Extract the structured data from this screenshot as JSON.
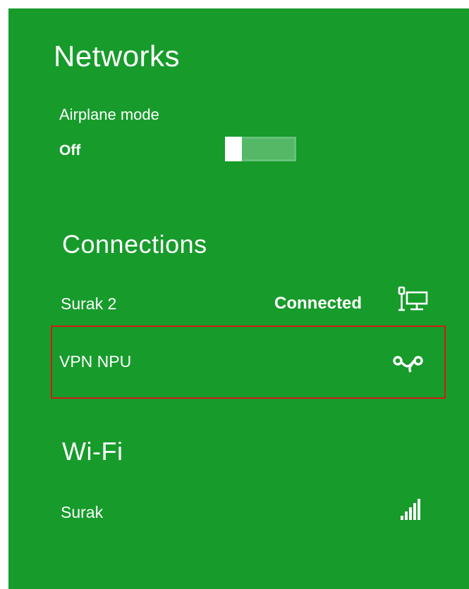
{
  "panel": {
    "title": "Networks",
    "background_color": "#179b2b"
  },
  "airplane_mode": {
    "label": "Airplane mode",
    "state": "Off",
    "toggle_on": false
  },
  "connections": {
    "title": "Connections",
    "items": [
      {
        "name": "Surak  2",
        "status": "Connected",
        "icon": "wired-network-icon"
      },
      {
        "name": "VPN NPU",
        "status": "",
        "icon": "vpn-icon",
        "highlighted": true,
        "highlight_color": "#d21a1a"
      }
    ]
  },
  "wifi": {
    "title": "Wi-Fi",
    "items": [
      {
        "name": "Surak",
        "icon": "wifi-signal-icon"
      }
    ]
  }
}
